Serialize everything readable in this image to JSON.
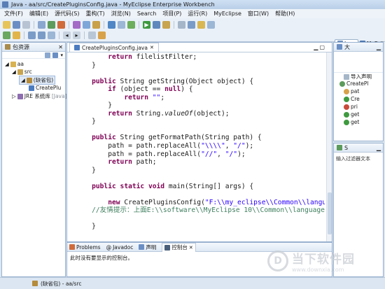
{
  "window": {
    "title": "Java - aa/src/CreatePluginsConfig.java - MyEclipse Enterprise Workbench"
  },
  "menu": [
    "文件(F)",
    "编辑(E)",
    "源代码(S)",
    "重构(T)",
    "浏览(N)",
    "Search",
    "项目(P)",
    "运行(R)",
    "MyEclipse",
    "窗口(W)",
    "帮助(H)"
  ],
  "perspectives": {
    "java": "Java",
    "myeclipse": "MyEcli"
  },
  "left_panel": {
    "title": "包资源",
    "tree": {
      "project": "aa",
      "src": "src",
      "default_package": "(缺省包)",
      "file": "CreatePlu",
      "jre": "JRE 系统库",
      "jre_suffix": "[Java]"
    }
  },
  "editor": {
    "tab": "CreatePluginsConfig.java",
    "lines": [
      {
        "html": "        <span class=\"kw\">return</span> filelistFilter;"
      },
      {
        "html": "    }"
      },
      {
        "html": ""
      },
      {
        "html": "    <span class=\"kw\">public</span> String getString(Object object) {"
      },
      {
        "html": "        <span class=\"kw\">if</span> (object == <span class=\"kw\">null</span>) {"
      },
      {
        "html": "            <span class=\"kw\">return</span> <span class=\"str\">\"\"</span>;"
      },
      {
        "html": "        }"
      },
      {
        "html": "        <span class=\"kw\">return</span> String.<span class=\"it\">valueOf</span>(object);"
      },
      {
        "html": "    }"
      },
      {
        "html": ""
      },
      {
        "html": "    <span class=\"kw\">public</span> String getFormatPath(String path) {"
      },
      {
        "html": "        path = path.replaceAll(<span class=\"str\">\"\\\\\\\\\"</span>, <span class=\"str\">\"/\"</span>);"
      },
      {
        "html": "        path = path.replaceAll(<span class=\"str\">\"//\"</span>, <span class=\"str\">\"/\"</span>);"
      },
      {
        "html": "        <span class=\"kw\">return</span> path;"
      },
      {
        "html": "    }"
      },
      {
        "html": ""
      },
      {
        "html": "    <span class=\"kw\">public static void</span> main(String[] args) {"
      },
      {
        "html": ""
      },
      {
        "html": "        <span class=\"kw\">new</span> CreatePluginsConfig(<span class=\"str\">\"F:\\\\my_eclipse\\\\Common\\\\language</span>"
      },
      {
        "html": "<span class=\"cmt\">    //友情提示：上面E:\\\\software\\\\MyEclipse 10\\\\Common\\\\language\\\\p</span>"
      },
      {
        "html": ""
      },
      {
        "html": "    }"
      }
    ]
  },
  "right_panel_top": {
    "title": "大",
    "items": [
      "导入声明",
      "CreatePl",
      "pat",
      "Cre",
      "pri",
      "get",
      "get"
    ]
  },
  "right_panel_bottom": {
    "title": "S",
    "filter_text": "输入过滤器文本"
  },
  "bottom_panel": {
    "tabs": [
      "Problems",
      "Javadoc",
      "声明",
      "控制台"
    ],
    "active_tab": "控制台",
    "message": "此时没有要显示的控制台。"
  },
  "status": {
    "text": "(缺省包) - aa/src"
  },
  "watermark": {
    "big": "当下软件园",
    "small": "www.downxia.com"
  }
}
